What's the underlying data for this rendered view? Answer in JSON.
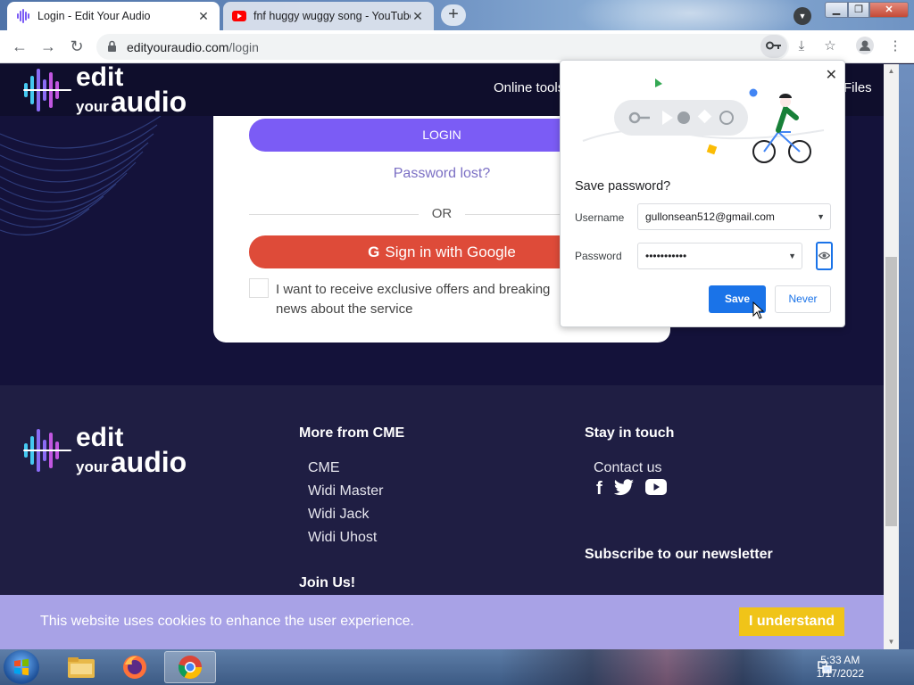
{
  "browser": {
    "tabs": [
      {
        "title": "Login - Edit Your Audio",
        "active": true
      },
      {
        "title": "fnf huggy wuggy song - YouTube",
        "active": false
      }
    ],
    "url_domain": "edityouraudio.com",
    "url_path": "/login"
  },
  "site": {
    "logo": {
      "edit": "edit",
      "your": "your",
      "audio": "audio"
    },
    "nav": {
      "online_tools": "Online tools",
      "files": "Files"
    }
  },
  "login_card": {
    "login_button": "LOGIN",
    "password_lost": "Password lost?",
    "or": "OR",
    "google_button": "Sign in with Google",
    "google_glyph": "G",
    "offers_checkbox_label": "I want to receive exclusive offers and breaking news about the service"
  },
  "footer": {
    "more_heading": "More from CME",
    "more_links": [
      "CME",
      "Widi Master",
      "Widi Jack",
      "Widi Uhost"
    ],
    "join_heading": "Join Us!",
    "stay_heading": "Stay in touch",
    "contact": "Contact us",
    "newsletter_heading": "Subscribe to our newsletter"
  },
  "cookie_banner": {
    "message": "This website uses cookies to enhance the user experience.",
    "button": "I understand"
  },
  "password_bubble": {
    "title": "Save password?",
    "username_label": "Username",
    "username_value": "gullonsean512@gmail.com",
    "password_label": "Password",
    "password_value": "•••••••••••",
    "save_button": "Save",
    "never_button": "Never"
  },
  "taskbar": {
    "time": "5:33 AM",
    "date": "1/17/2022"
  },
  "colors": {
    "purple_button": "#7b5cf5",
    "google_red": "#de4b39",
    "cookie_bg": "#a8a2e6",
    "cookie_button": "#f0c419",
    "chrome_blue": "#1a73e8"
  }
}
